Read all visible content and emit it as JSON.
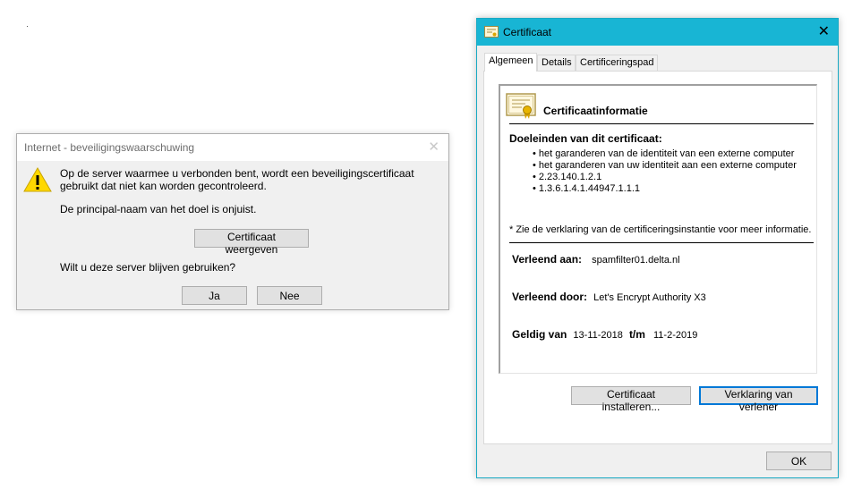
{
  "warning_dialog": {
    "title": "Internet - beveiligingswaarschuwing",
    "message": "Op de server waarmee u verbonden bent, wordt een beveiligingscertificaat gebruikt dat niet kan worden gecontroleerd.",
    "detail": "De principal-naam van het doel is onjuist.",
    "view_cert_button": "Certificaat weergeven",
    "question": "Wilt u deze server blijven gebruiken?",
    "yes_button": "Ja",
    "no_button": "Nee",
    "icon": "warning-icon"
  },
  "cert_dialog": {
    "title": "Certificaat",
    "tabs": [
      {
        "label": "Algemeen"
      },
      {
        "label": "Details"
      },
      {
        "label": "Certificeringspad"
      }
    ],
    "info_title": "Certificaatinformatie",
    "purposes_heading": "Doeleinden van dit certificaat:",
    "purposes": [
      "het garanderen van de identiteit van een externe computer",
      "het garanderen van uw identiteit aan een externe computer",
      "2.23.140.1.2.1",
      "1.3.6.1.4.1.44947.1.1.1"
    ],
    "note": "* Zie de verklaring van de certificeringsinstantie voor meer informatie.",
    "issued_to_label": "Verleend aan:",
    "issued_to": "spamfilter01.delta.nl",
    "issued_by_label": "Verleend door:",
    "issued_by": "Let's Encrypt Authority X3",
    "valid_from_label": "Geldig van",
    "valid_from": "13-11-2018",
    "valid_to_label": "t/m",
    "valid_to": "11-2-2019",
    "install_button": "Certificaat installeren...",
    "statement_button": "Verklaring van verlener",
    "ok_button": "OK"
  },
  "colors": {
    "cert_titlebar": "#18b5d4",
    "focus_border": "#0078d7",
    "warning_yellow": "#ffd800"
  }
}
